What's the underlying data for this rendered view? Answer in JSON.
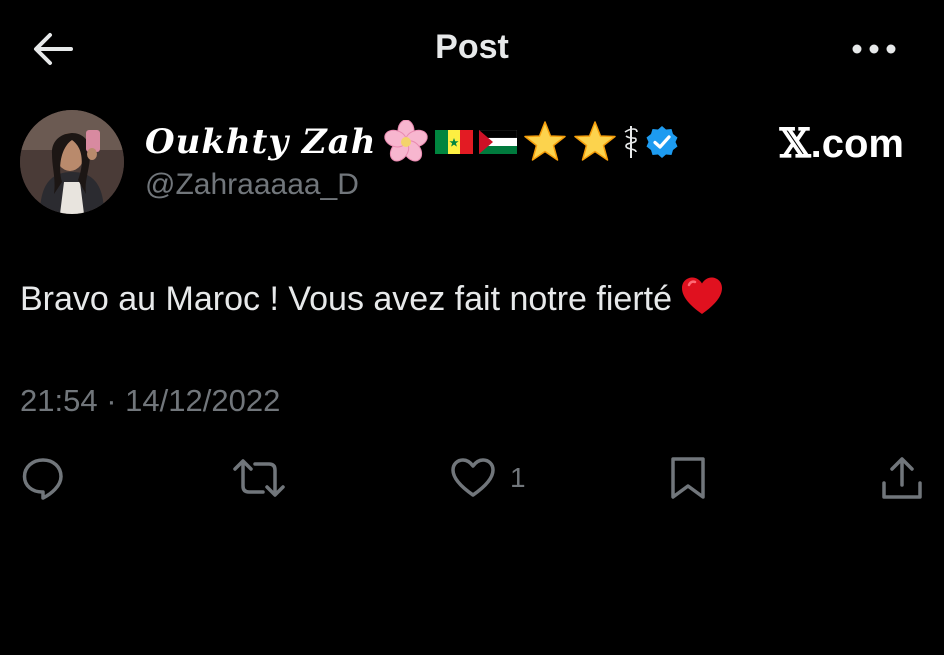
{
  "header": {
    "title": "Post",
    "back_icon": "arrow-left-icon",
    "more_icon": "more-horizontal-icon"
  },
  "author": {
    "display_name": "Oukhty Zah",
    "handle": "@Zahraaaaa_D",
    "badges": [
      "cherry-blossom-emoji",
      "senegal-flag",
      "palestine-flag",
      "star-emoji",
      "star-emoji",
      "caduceus-symbol",
      "verified-badge"
    ],
    "verified_color": "#1d9bf0"
  },
  "watermark": {
    "x": "𝕏",
    "text": ".com"
  },
  "tweet": {
    "text": "Bravo au Maroc ! Vous avez fait notre fierté",
    "emoji": "red-heart-emoji"
  },
  "meta": {
    "time": "21:54",
    "separator": "·",
    "date": "14/12/2022"
  },
  "actions": {
    "reply_icon": "reply-icon",
    "repost_icon": "repost-icon",
    "like_icon": "heart-icon",
    "like_count": "1",
    "bookmark_icon": "bookmark-icon",
    "share_icon": "share-icon"
  },
  "colors": {
    "background": "#000000",
    "primary_text": "#e7e9ea",
    "secondary_text": "#71767b",
    "verified": "#1d9bf0",
    "heart": "#e0111f"
  }
}
